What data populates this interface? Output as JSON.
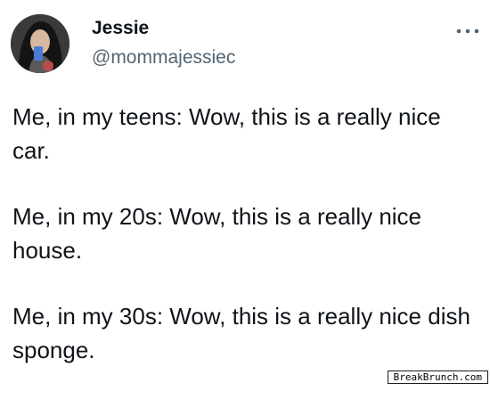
{
  "tweet": {
    "author": {
      "display_name": "Jessie",
      "handle": "@mommajessiec"
    },
    "more_icon": "more-horizontal-icon",
    "paragraphs": [
      "Me, in my teens: Wow, this is a really nice car.",
      "Me, in my 20s: Wow, this is a really nice house.",
      "Me, in my 30s: Wow, this is a really nice dish sponge."
    ]
  },
  "watermark": {
    "text": "BreakBrunch.com"
  },
  "colors": {
    "primary_text": "#0f1419",
    "secondary_text": "#536471"
  }
}
